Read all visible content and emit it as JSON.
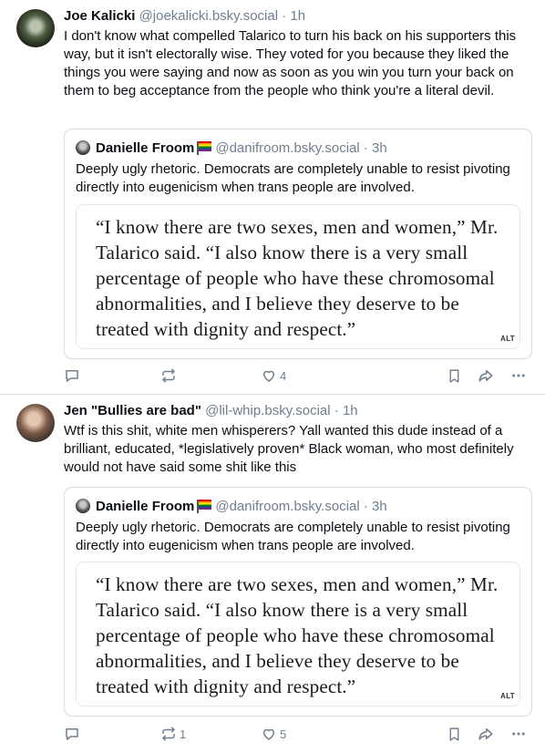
{
  "posts": [
    {
      "author": "Joe Kalicki",
      "handle": "@joekalicki.bsky.social",
      "time": "1h",
      "text": "I don't know what compelled Talarico to turn his back on his supporters this way, but it isn't electorally wise. They voted for you because they liked the things you were saying and now as soon as you win you turn your back on them to beg acceptance from the people who think you're a literal devil.",
      "quote": {
        "author": "Danielle Froom",
        "handle": "@danifroom.bsky.social",
        "time": "3h",
        "text": "Deeply ugly rhetoric. Democrats are completely unable to resist pivoting directly into eugenicism when trans people are involved.",
        "image_text": "“I know there are two sexes, men and women,” Mr. Talarico said. “I also know there is a very small percentage of people who have these chromosomal abnormalities, and I believe they deserve to be treated with dignity and respect.”",
        "alt_badge": "ALT"
      },
      "reposts": "",
      "likes": "4"
    },
    {
      "author": "Jen \"Bullies are bad\"",
      "handle": "@lil-whip.bsky.social",
      "time": "1h",
      "text": "Wtf is this shit, white men whisperers? Yall wanted this dude instead of a brilliant, educated, *legislatively proven* Black woman, who most definitely would not have said some shit like this",
      "quote": {
        "author": "Danielle Froom",
        "handle": "@danifroom.bsky.social",
        "time": "3h",
        "text": "Deeply ugly rhetoric. Democrats are completely unable to resist pivoting directly into eugenicism when trans people are involved.",
        "image_text": "“I know there are two sexes, men and women,” Mr. Talarico said. “I also know there is a very small percentage of people who have these chromosomal abnormalities, and I believe they deserve to be treated with dignity and respect.”",
        "alt_badge": "ALT"
      },
      "reposts": "1",
      "likes": "5"
    }
  ],
  "separator": "·",
  "colors": {
    "text": "#0b0f14",
    "muted": "#6f7f8f",
    "border": "#d4dbe2"
  },
  "icons": [
    "reply-icon",
    "repost-icon",
    "like-icon",
    "bookmark-icon",
    "share-icon",
    "more-icon",
    "pride-flag-icon"
  ]
}
